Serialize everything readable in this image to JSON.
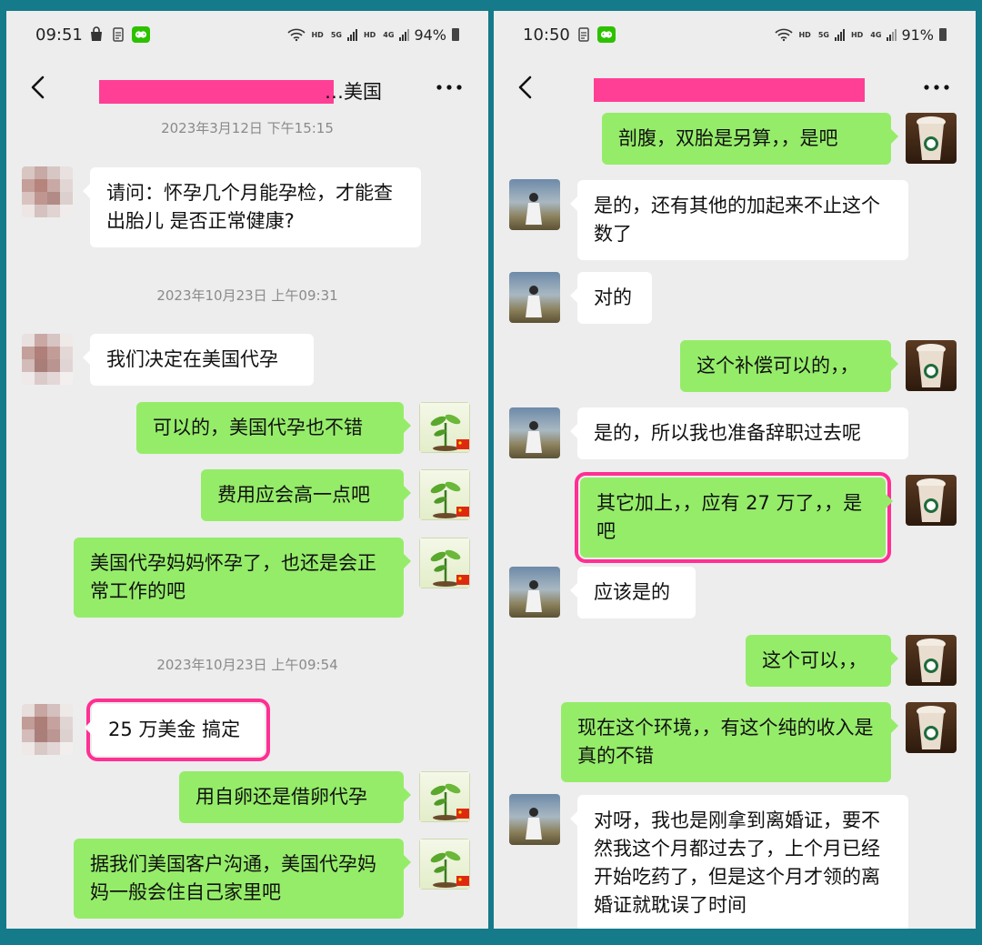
{
  "left": {
    "status": {
      "time": "09:51",
      "battery": "94%",
      "net_labels": [
        "HD",
        "5G",
        "HD",
        "4G"
      ]
    },
    "header": {
      "title_suffix": "…美国"
    },
    "timestamps": [
      "2023年3月12日 下午15:15",
      "2023年10月23日 上午09:31",
      "2023年10月23日 上午09:54"
    ],
    "messages": [
      {
        "side": "in",
        "text": "请问：怀孕几个月能孕检，才能查出胎儿 是否正常健康?"
      },
      {
        "side": "in",
        "text": "我们决定在美国代孕"
      },
      {
        "side": "out",
        "text": "可以的，美国代孕也不错"
      },
      {
        "side": "out",
        "text": "费用应会高一点吧"
      },
      {
        "side": "out",
        "text": "美国代孕妈妈怀孕了，也还是会正常工作的吧"
      },
      {
        "side": "in",
        "text": "25 万美金 搞定",
        "highlighted": true
      },
      {
        "side": "out",
        "text": "用自卵还是借卵代孕"
      },
      {
        "side": "out",
        "text": "据我们美国客户沟通，美国代孕妈妈一般会住自己家里吧"
      }
    ]
  },
  "right": {
    "status": {
      "time": "10:50",
      "battery": "91%",
      "net_labels": [
        "HD",
        "5G",
        "HD",
        "4G"
      ]
    },
    "messages": [
      {
        "side": "out",
        "text": "剖腹，双胎是另算，，是吧"
      },
      {
        "side": "in",
        "text": "是的，还有其他的加起来不止这个数了"
      },
      {
        "side": "in",
        "text": "对的"
      },
      {
        "side": "out",
        "text": "这个补偿可以的，，"
      },
      {
        "side": "in",
        "text": "是的，所以我也准备辞职过去呢"
      },
      {
        "side": "out",
        "text": "其它加上，，应有 27 万了，，是吧",
        "highlighted": true
      },
      {
        "side": "in",
        "text": "应该是的"
      },
      {
        "side": "out",
        "text": "这个可以，，"
      },
      {
        "side": "out",
        "text": "现在这个环境，，有这个纯的收入是真的不错"
      },
      {
        "side": "in",
        "text": "对呀，我也是刚拿到离婚证，要不然我这个月都过去了，上个月已经开始吃药了，但是这个月才领的离婚证就耽误了时间"
      }
    ]
  },
  "colors": {
    "frame": "#157a8a",
    "chat_bg": "#ededed",
    "green_bubble": "#95ec69",
    "white_bubble": "#ffffff",
    "highlight": "#ff2f93",
    "redaction": "#ff3f95"
  },
  "icons": {
    "back": "chevron-left-icon",
    "more": "more-dots-icon",
    "wechat": "wechat-icon",
    "battery": "battery-icon",
    "wifi": "wifi-icon"
  }
}
